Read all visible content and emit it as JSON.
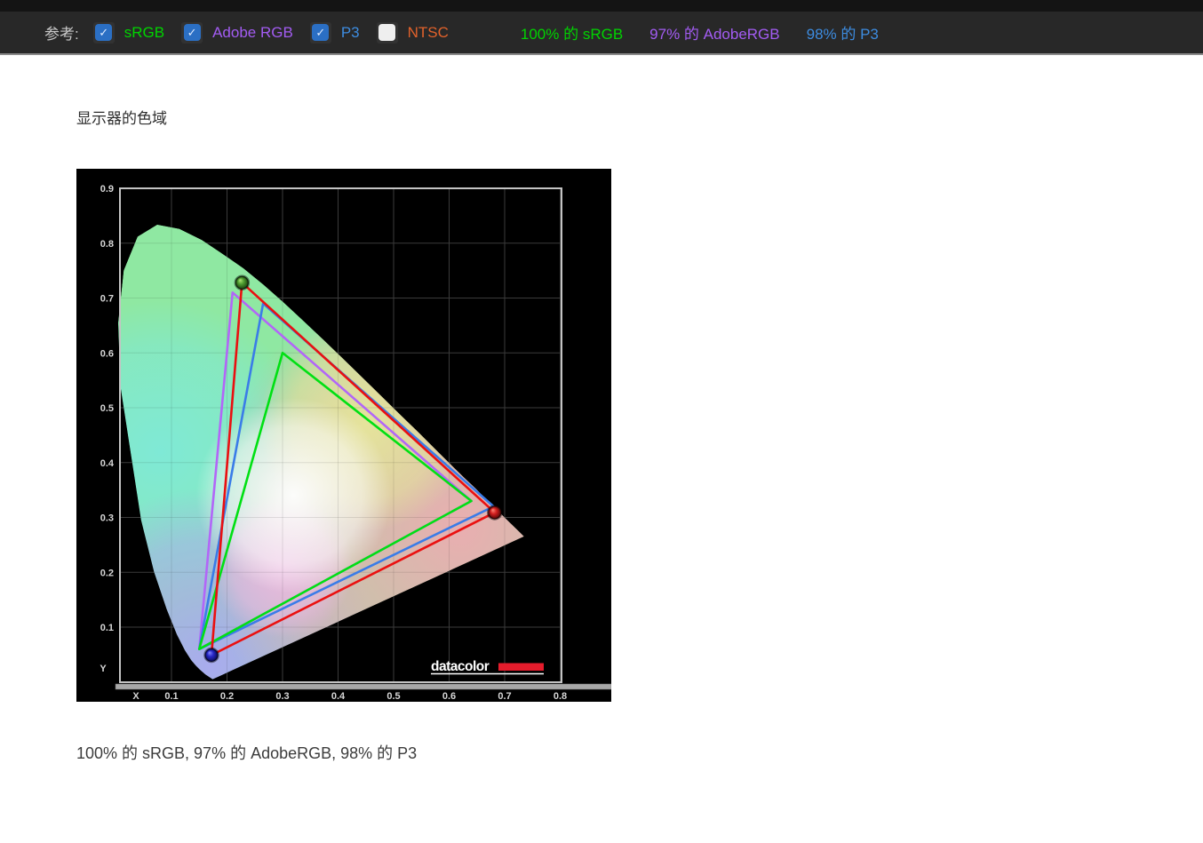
{
  "toolbar": {
    "reference_label": "参考:",
    "checkboxes": [
      {
        "id": "srgb",
        "label": "sRGB",
        "checked": true,
        "color": "#00d400"
      },
      {
        "id": "adobergb",
        "label": "Adobe RGB",
        "checked": true,
        "color": "#a35cf3"
      },
      {
        "id": "p3",
        "label": "P3",
        "checked": true,
        "color": "#3d8ce0"
      },
      {
        "id": "ntsc",
        "label": "NTSC",
        "checked": false,
        "color": "#e2622b"
      }
    ],
    "checkbox_checked_color": "#2b6fc4",
    "check_glyph": "✓",
    "stats": [
      {
        "id": "stat-srgb",
        "text": "100% 的 sRGB",
        "color": "#00d400"
      },
      {
        "id": "stat-adobergb",
        "text": "97% 的 AdobeRGB",
        "color": "#a35cf3"
      },
      {
        "id": "stat-p3",
        "text": "98% 的 P3",
        "color": "#3d8ce0"
      }
    ]
  },
  "main": {
    "title": "显示器的色域",
    "result_line": "100% 的 sRGB, 97% 的 AdobeRGB, 98% 的 P3"
  },
  "chart_data": {
    "type": "chromaticity-diagram",
    "title": "显示器的色域",
    "xlabel": "X",
    "ylabel": "Y",
    "xlim": [
      0,
      0.8
    ],
    "ylim": [
      0,
      0.9
    ],
    "x_ticks": [
      0.1,
      0.2,
      0.3,
      0.4,
      0.5,
      0.6,
      0.7,
      0.8
    ],
    "y_ticks": [
      0.1,
      0.2,
      0.3,
      0.4,
      0.5,
      0.6,
      0.7,
      0.8,
      0.9
    ],
    "grid": true,
    "background": "#000000",
    "logo_text": "datacolor",
    "logo_bar_color": "#e51c2c",
    "coverage": {
      "sRGB": "100%",
      "AdobeRGB": "97%",
      "P3": "98%"
    },
    "gamuts": [
      {
        "name": "Adobe RGB",
        "color": "#b266f8",
        "red": [
          0.64,
          0.33
        ],
        "green": [
          0.21,
          0.71
        ],
        "blue": [
          0.15,
          0.06
        ],
        "markers": false
      },
      {
        "name": "P3",
        "color": "#3a7ce8",
        "red": [
          0.68,
          0.32
        ],
        "green": [
          0.265,
          0.69
        ],
        "blue": [
          0.15,
          0.06
        ],
        "markers": false
      },
      {
        "name": "sRGB",
        "color": "#00e013",
        "red": [
          0.64,
          0.33
        ],
        "green": [
          0.3,
          0.6
        ],
        "blue": [
          0.15,
          0.06
        ],
        "markers": false
      },
      {
        "name": "Display",
        "color": "#ea1010",
        "red": [
          0.682,
          0.309
        ],
        "green": [
          0.227,
          0.728
        ],
        "blue": [
          0.172,
          0.049
        ],
        "markers": true
      }
    ],
    "spectral_locus": [
      [
        0.1741,
        0.005
      ],
      [
        0.169,
        0.0085
      ],
      [
        0.1611,
        0.0138
      ],
      [
        0.151,
        0.0227
      ],
      [
        0.144,
        0.0297
      ],
      [
        0.1355,
        0.0399
      ],
      [
        0.1241,
        0.0578
      ],
      [
        0.1096,
        0.0868
      ],
      [
        0.0913,
        0.1327
      ],
      [
        0.0687,
        0.2007
      ],
      [
        0.0454,
        0.295
      ],
      [
        0.0082,
        0.5384
      ],
      [
        0.0039,
        0.6548
      ],
      [
        0.0139,
        0.7502
      ],
      [
        0.0389,
        0.812
      ],
      [
        0.0743,
        0.8338
      ],
      [
        0.1142,
        0.8262
      ],
      [
        0.1547,
        0.8059
      ],
      [
        0.1896,
        0.7822
      ],
      [
        0.2296,
        0.7543
      ],
      [
        0.2658,
        0.7243
      ],
      [
        0.3016,
        0.6923
      ],
      [
        0.3373,
        0.6588
      ],
      [
        0.3731,
        0.6245
      ],
      [
        0.4087,
        0.5896
      ],
      [
        0.4441,
        0.5547
      ],
      [
        0.4788,
        0.5202
      ],
      [
        0.5125,
        0.4866
      ],
      [
        0.5448,
        0.455
      ],
      [
        0.5752,
        0.4242
      ],
      [
        0.6029,
        0.3965
      ],
      [
        0.627,
        0.3725
      ],
      [
        0.6482,
        0.3523
      ],
      [
        0.6658,
        0.334
      ],
      [
        0.6801,
        0.3197
      ],
      [
        0.6915,
        0.3083
      ],
      [
        0.7079,
        0.292
      ],
      [
        0.719,
        0.2809
      ],
      [
        0.726,
        0.274
      ],
      [
        0.7347,
        0.2653
      ]
    ],
    "color_patches": [
      {
        "cx": 0.08,
        "cy": 0.42,
        "r": 170,
        "color": "#7fe9d6",
        "opacity": 1
      },
      {
        "cx": 0.17,
        "cy": 0.03,
        "r": 200,
        "color": "#a9abee",
        "opacity": 1
      },
      {
        "cx": 0.62,
        "cy": 0.28,
        "r": 290,
        "color": "#e9aeb0",
        "opacity": 1
      },
      {
        "cx": 0.45,
        "cy": 0.47,
        "r": 120,
        "color": "#e7e59a",
        "opacity": 0.95
      },
      {
        "cx": 0.3,
        "cy": 0.21,
        "r": 80,
        "color": "#eebbe4",
        "opacity": 0.9
      },
      {
        "cx": 0.32,
        "cy": 0.34,
        "r": 110,
        "color": "#ffffff",
        "opacity": 0.95
      }
    ],
    "locus_base_color": "#8fe8a2"
  }
}
